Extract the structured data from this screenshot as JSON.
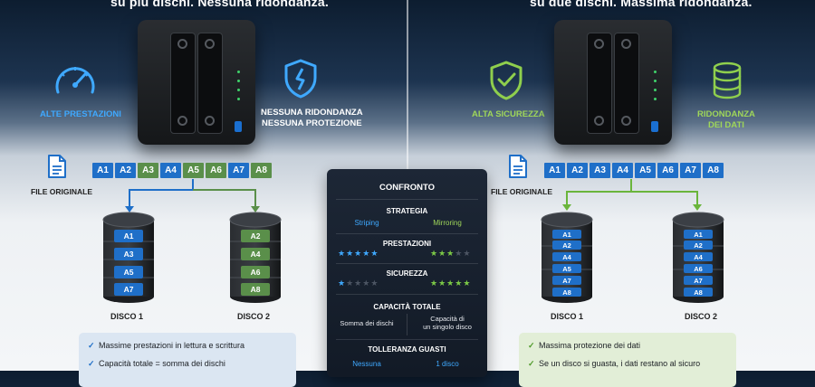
{
  "left": {
    "headline": "su più dischi. Nessuna ridondanza.",
    "feature_1": "ALTE PRESTAZIONI",
    "feature_2_line1": "NESSUNA RIDONDANZA",
    "feature_2_line2": "NESSUNA PROTEZIONE",
    "file_label": "FILE ORIGINALE",
    "blocks": [
      "A1",
      "A2",
      "A3",
      "A4",
      "A5",
      "A6",
      "A7",
      "A8"
    ],
    "disk1": {
      "label": "DISCO 1",
      "chips": [
        "A1",
        "A3",
        "A5",
        "A7"
      ]
    },
    "disk2": {
      "label": "DISCO 2",
      "chips": [
        "A2",
        "A4",
        "A6",
        "A8"
      ]
    },
    "benefits": [
      "Massime prestazioni in lettura e scrittura",
      "Capacità totale = somma dei dischi"
    ],
    "colors": {
      "accent": "#1f6fc8",
      "secondary": "#5a8f4a"
    }
  },
  "right": {
    "headline": "su due dischi. Massima ridondanza.",
    "feature_1": "ALTA SICUREZZA",
    "feature_2_line1": "RIDONDANZA",
    "feature_2_line2": "DEI DATI",
    "file_label": "FILE ORIGINALE",
    "blocks": [
      "A1",
      "A2",
      "A3",
      "A4",
      "A5",
      "A6",
      "A7",
      "A8"
    ],
    "disk1": {
      "label": "DISCO 1",
      "chips": [
        "A1",
        "A2",
        "A4",
        "A5",
        "A7",
        "A8"
      ]
    },
    "disk2": {
      "label": "DISCO 2",
      "chips": [
        "A1",
        "A2",
        "A4",
        "A6",
        "A7",
        "A8"
      ]
    },
    "benefits": [
      "Massima protezione dei dati",
      "Se un disco si guasta, i dati restano al sicuro"
    ],
    "colors": {
      "accent": "#9fd65a"
    }
  },
  "comparison": {
    "title": "CONFRONTO",
    "strategy_label": "STRATEGIA",
    "strategy_left": "Striping",
    "strategy_right": "Mirroring",
    "performance_label": "PRESTAZIONI",
    "performance_left_rating": 5,
    "performance_right_rating": 3,
    "security_label": "SICUREZZA",
    "security_left_rating": 1,
    "security_right_rating": 5,
    "capacity_label": "CAPACITÀ TOTALE",
    "capacity_left": "Somma dei dischi",
    "capacity_right_line1": "Capacità di",
    "capacity_right_line2": "un singolo disco",
    "tolerance_label": "TOLLERANZA GUASTI",
    "tolerance_left": "Nessuna",
    "tolerance_right": "1 disco"
  },
  "icons": {
    "left_1": "speedometer-icon",
    "left_2": "broken-shield-icon",
    "right_1": "shield-check-icon",
    "right_2": "database-icon",
    "file": "document-icon",
    "check": "checkmark-icon",
    "star": "star-icon"
  }
}
